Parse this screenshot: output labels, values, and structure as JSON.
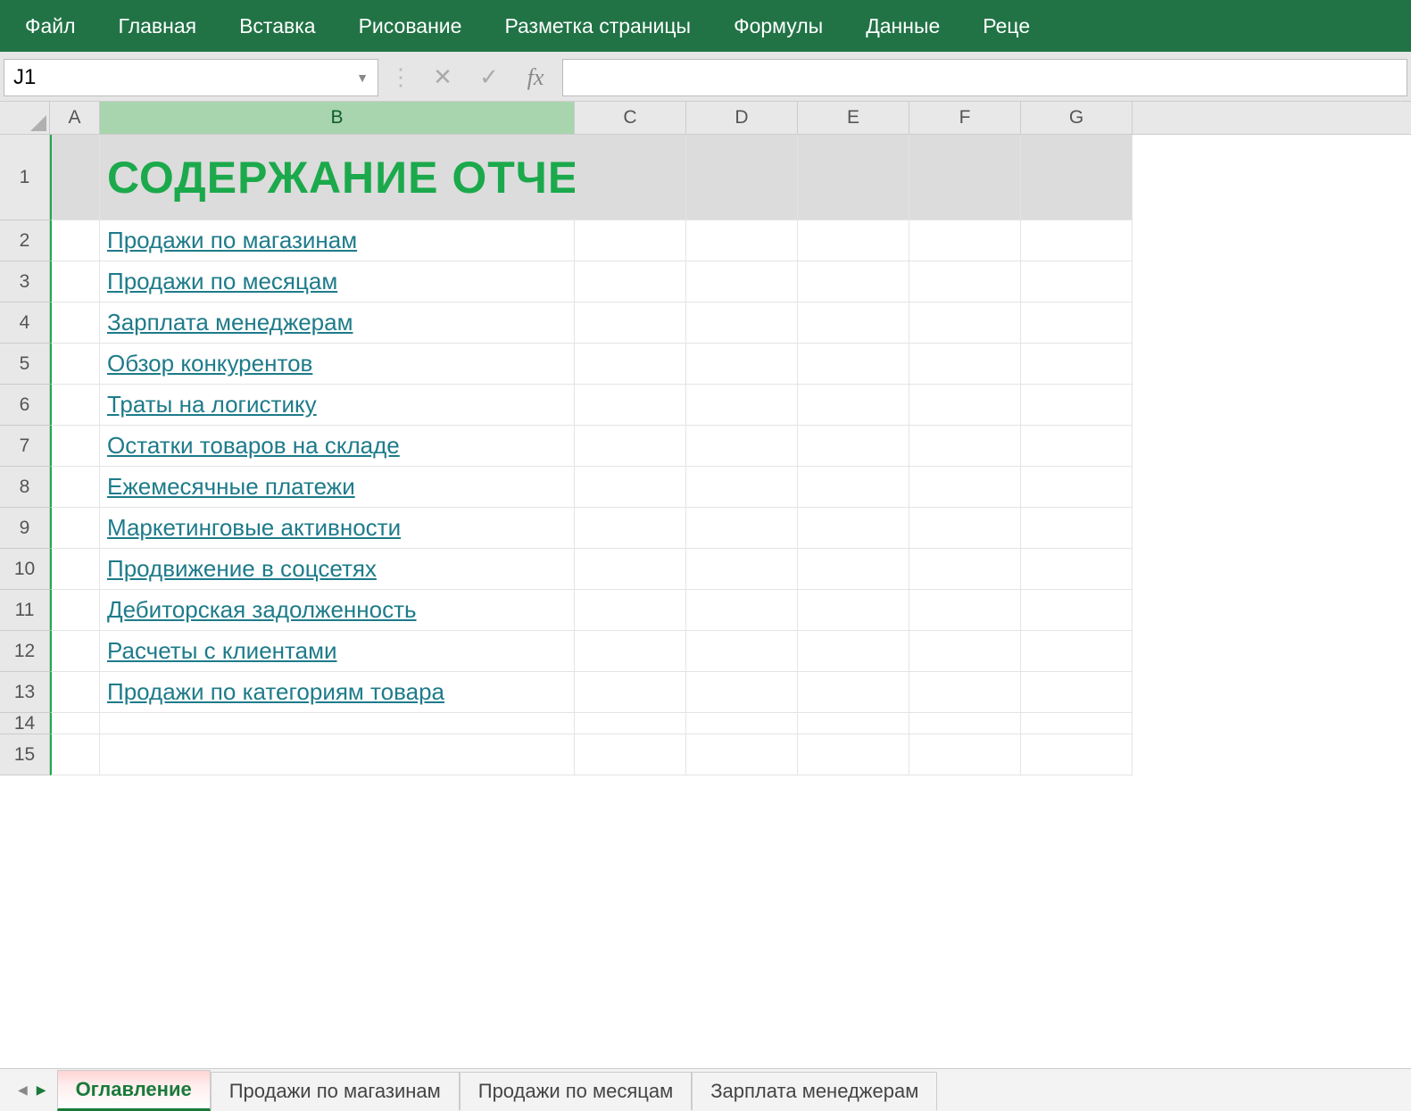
{
  "ribbon": {
    "items": [
      "Файл",
      "Главная",
      "Вставка",
      "Рисование",
      "Разметка страницы",
      "Формулы",
      "Данные",
      "Реце"
    ]
  },
  "formula_bar": {
    "name_box_value": "J1",
    "fx_label": "fx"
  },
  "columns": [
    "A",
    "B",
    "C",
    "D",
    "E",
    "F",
    "G"
  ],
  "selected_column": "B",
  "title": "СОДЕРЖАНИЕ ОТЧЕТА",
  "links": [
    "Продажи по магазинам",
    "Продажи по месяцам",
    "Зарплата менеджерам",
    "Обзор конкурентов",
    "Траты на логистику",
    "Остатки товаров на складе",
    "Ежемесячные платежи",
    "Маркетинговые активности",
    "Продвижение в соцсетях",
    "Дебиторская задолженность",
    "Расчеты с клиентами",
    "Продажи по категориям товара"
  ],
  "row_numbers": [
    "1",
    "2",
    "3",
    "4",
    "5",
    "6",
    "7",
    "8",
    "9",
    "10",
    "11",
    "12",
    "13",
    "14",
    "15"
  ],
  "sheet_tabs": {
    "active": "Оглавление",
    "others": [
      "Продажи по магазинам",
      "Продажи по месяцам",
      "Зарплата менеджерам"
    ]
  }
}
